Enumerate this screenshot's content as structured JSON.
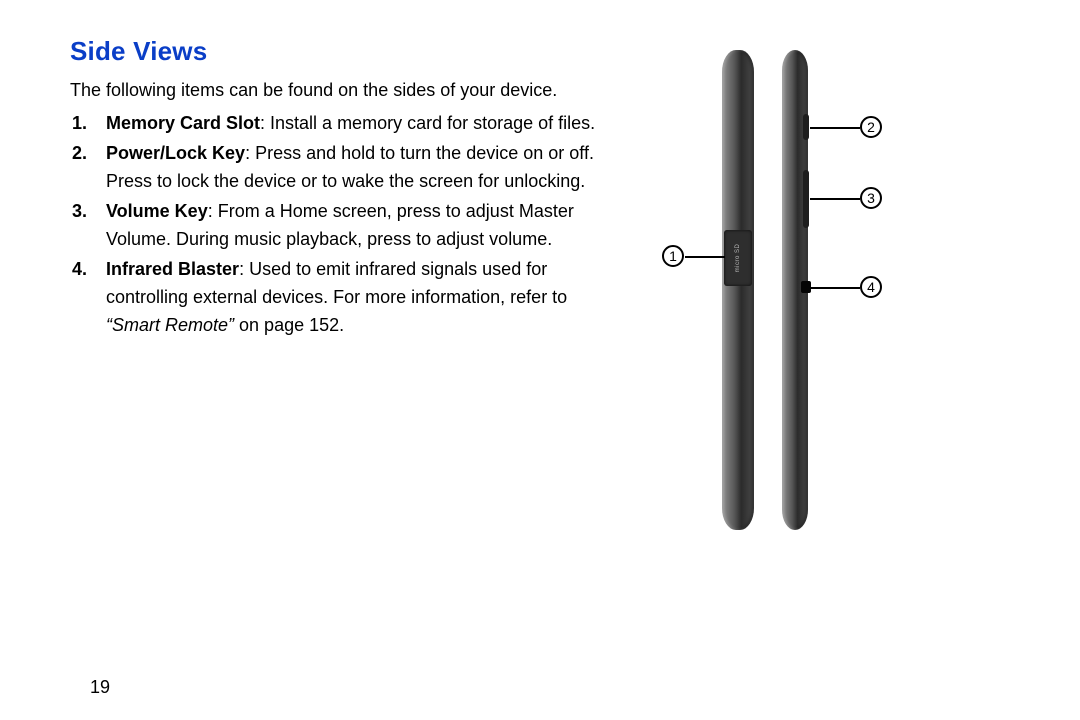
{
  "heading": "Side Views",
  "intro": "The following items can be found on the sides of your device.",
  "items": [
    {
      "label": "Memory Card Slot",
      "desc": ": Install a memory card for storage of files."
    },
    {
      "label": "Power/Lock Key",
      "desc": ": Press and hold to turn the device on or off. Press to lock the device or to wake the screen for unlocking."
    },
    {
      "label": "Volume Key",
      "desc": ": From a Home screen, press to adjust Master Volume. During music playback, press to adjust volume."
    },
    {
      "label": "Infrared Blaster",
      "desc": ": Used to emit infrared signals used for controlling external devices. For more information, refer to ",
      "xref": "“Smart Remote”",
      "desc_tail": "  on page 152."
    }
  ],
  "callouts": {
    "c1": "1",
    "c2": "2",
    "c3": "3",
    "c4": "4"
  },
  "page_number": "19"
}
